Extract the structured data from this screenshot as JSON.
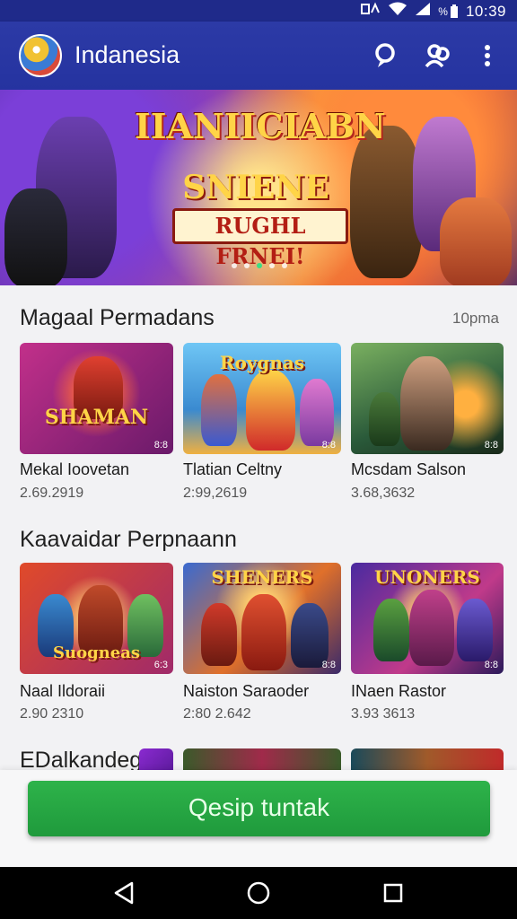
{
  "status_bar": {
    "time": "10:39",
    "battery_text": "%"
  },
  "app_bar": {
    "title": "Indanesia"
  },
  "hero": {
    "title": "IIANIICIABN",
    "subtitle": "SNIENE",
    "tagline": "RUGHL FRNEI!",
    "carousel_dot_count": 5,
    "carousel_active_index": 2
  },
  "sections": [
    {
      "title": "Magaal Permadans",
      "more_label": "10pma",
      "cards": [
        {
          "name": "Mekal Ioovetan",
          "meta": "2.69.2919",
          "image_text": "SHAMAN",
          "badge": "8:8"
        },
        {
          "name": "Tlatian Celtny",
          "meta": "2:99,2619",
          "image_text": "Roygnas",
          "badge": "8:8"
        },
        {
          "name": "Mcsdam Salson",
          "meta": "3.68,3632",
          "image_text": "",
          "badge": "8:8"
        }
      ]
    },
    {
      "title": "Kaavaidar Perpnaann",
      "more_label": "",
      "cards": [
        {
          "name": "Naal Ildoraii",
          "meta": "2.90 2310",
          "image_text": "Suogneas",
          "badge": "6:3"
        },
        {
          "name": "Naiston Saraoder",
          "meta": "2:80 2.642",
          "image_text": "SHENERS",
          "badge": "8:8"
        },
        {
          "name": "INaen Rastor",
          "meta": "3.93 3613",
          "image_text": "UNONERS",
          "badge": "8:8"
        }
      ]
    },
    {
      "title": "EDalkandeg",
      "more_label": "",
      "cards": []
    }
  ],
  "cta": {
    "label": "Qesip tuntak"
  },
  "colors": {
    "primary": "#2533a0",
    "cta": "#26a844"
  }
}
